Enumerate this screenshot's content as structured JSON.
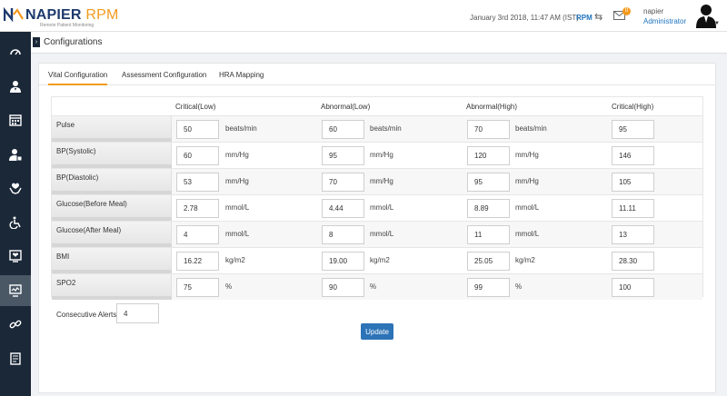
{
  "header": {
    "brand": "NAPIER",
    "brand_suffix": "RPM",
    "tagline": "Remote Patient Monitoring",
    "datetime": "January 3rd 2018, 11:47 AM (IST)",
    "rpm_link": "RPM",
    "notification_count": "0",
    "user_name": "napier",
    "user_role": "Administrator"
  },
  "page": {
    "title": "Configurations"
  },
  "tabs": [
    {
      "label": "Vital Configuration"
    },
    {
      "label": "Assessment Configuration"
    },
    {
      "label": "HRA Mapping"
    }
  ],
  "table": {
    "columns": [
      "Critical(Low)",
      "Abnormal(Low)",
      "Abnormal(High)",
      "Critical(High)"
    ],
    "rows": [
      {
        "label": "Pulse",
        "values": [
          "50",
          "60",
          "70",
          "95"
        ],
        "unit": "beats/min"
      },
      {
        "label": "BP(Systolic)",
        "values": [
          "60",
          "95",
          "120",
          "146"
        ],
        "unit": "mm/Hg"
      },
      {
        "label": "BP(Diastolic)",
        "values": [
          "53",
          "70",
          "95",
          "105"
        ],
        "unit": "mm/Hg"
      },
      {
        "label": "Glucose(Before Meal)",
        "values": [
          "2.78",
          "4.44",
          "8.89",
          "11.11"
        ],
        "unit": "mmol/L"
      },
      {
        "label": "Glucose(After Meal)",
        "values": [
          "4",
          "8",
          "11",
          "13"
        ],
        "unit": "mmol/L"
      },
      {
        "label": "BMI",
        "values": [
          "16.22",
          "19.00",
          "25.05",
          "28.30"
        ],
        "unit": "kg/m2"
      },
      {
        "label": "SPO2",
        "values": [
          "75",
          "90",
          "99",
          "100"
        ],
        "unit": "%"
      }
    ]
  },
  "alerts": {
    "label": "Consecutive Alerts :",
    "value": "4"
  },
  "update_label": "Update",
  "colors": {
    "accent": "#f39a1e",
    "primary": "#2d73b8",
    "sidebar": "#1b2838"
  },
  "sidebar_icons": [
    "dashboard-icon",
    "doctor-icon",
    "calendar-icon",
    "patient-icon",
    "care-hands-icon",
    "wheelchair-icon",
    "heart-monitor-icon",
    "configuration-monitor-icon",
    "link-icon",
    "report-icon"
  ]
}
